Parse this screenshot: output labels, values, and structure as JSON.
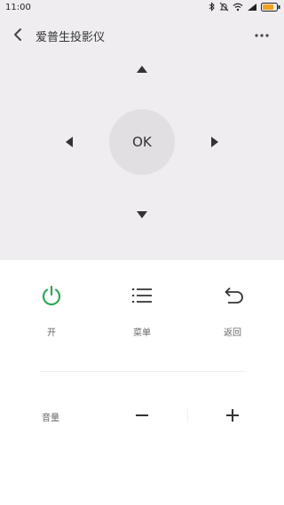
{
  "status_bar": {
    "time": "11:00",
    "icons": [
      "bluetooth-icon",
      "alarm-off-icon",
      "wifi-icon",
      "signal-icon",
      "battery-icon"
    ]
  },
  "header": {
    "title": "爱普生投影仪",
    "back_icon": "chevron-left-icon",
    "more_icon": "more-dots-icon"
  },
  "dpad": {
    "ok_label": "OK",
    "up_icon": "triangle-up-icon",
    "down_icon": "triangle-down-icon",
    "left_icon": "triangle-left-icon",
    "right_icon": "triangle-right-icon"
  },
  "controls": {
    "power": {
      "label": "开",
      "icon": "power-icon",
      "color": "#2aa952"
    },
    "menu": {
      "label": "菜单",
      "icon": "menu-list-icon"
    },
    "back": {
      "label": "返回",
      "icon": "undo-return-icon"
    }
  },
  "volume": {
    "label": "音量",
    "minus_icon": "minus-icon",
    "plus_icon": "plus-icon"
  },
  "colors": {
    "top_background": "#efedf0",
    "ok_circle": "#e1dfe1",
    "accent_power": "#2aa952"
  }
}
